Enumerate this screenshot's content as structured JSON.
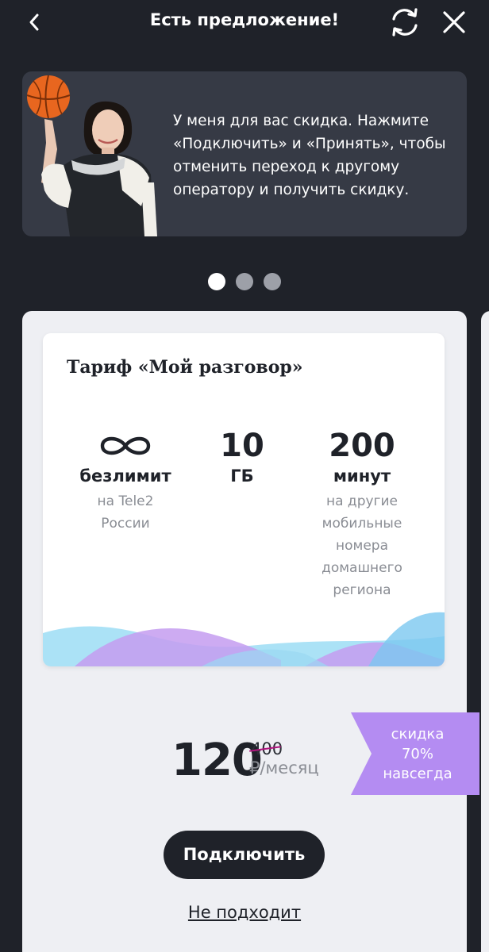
{
  "header": {
    "title": "Есть предложение!",
    "back_icon": "chevron-left-icon",
    "refresh_icon": "refresh-icon",
    "close_icon": "close-icon"
  },
  "promo": {
    "text": "У меня для вас скидка. Нажмите «Подключить» и «Принять», чтобы отменить переход к другому оператору и получить скидку."
  },
  "carousel": {
    "pages": 3,
    "active": 0
  },
  "tariff": {
    "name": "Тариф «Мой разговор»",
    "features": [
      {
        "value": "∞",
        "icon": "infinity-icon",
        "unit": "безлимит",
        "desc": "на Tele2 России"
      },
      {
        "value": "10",
        "unit": "ГБ",
        "desc": ""
      },
      {
        "value": "200",
        "unit": "минут",
        "desc": "на другие мобильные номера домашнего региона"
      }
    ]
  },
  "price": {
    "current": "120",
    "old": "400",
    "unit": "₽/месяц"
  },
  "discount": {
    "line1": "скидка",
    "line2": "70%",
    "line3": "навсегда",
    "color": "#b48cf2"
  },
  "actions": {
    "connect_label": "Подключить",
    "decline_label": "Не подходит"
  },
  "colors": {
    "background": "#1f2229",
    "banner": "#363a45",
    "card": "#eeeff3",
    "accent_purple": "#b48cf2",
    "accent_blue": "#7fd3f2"
  }
}
